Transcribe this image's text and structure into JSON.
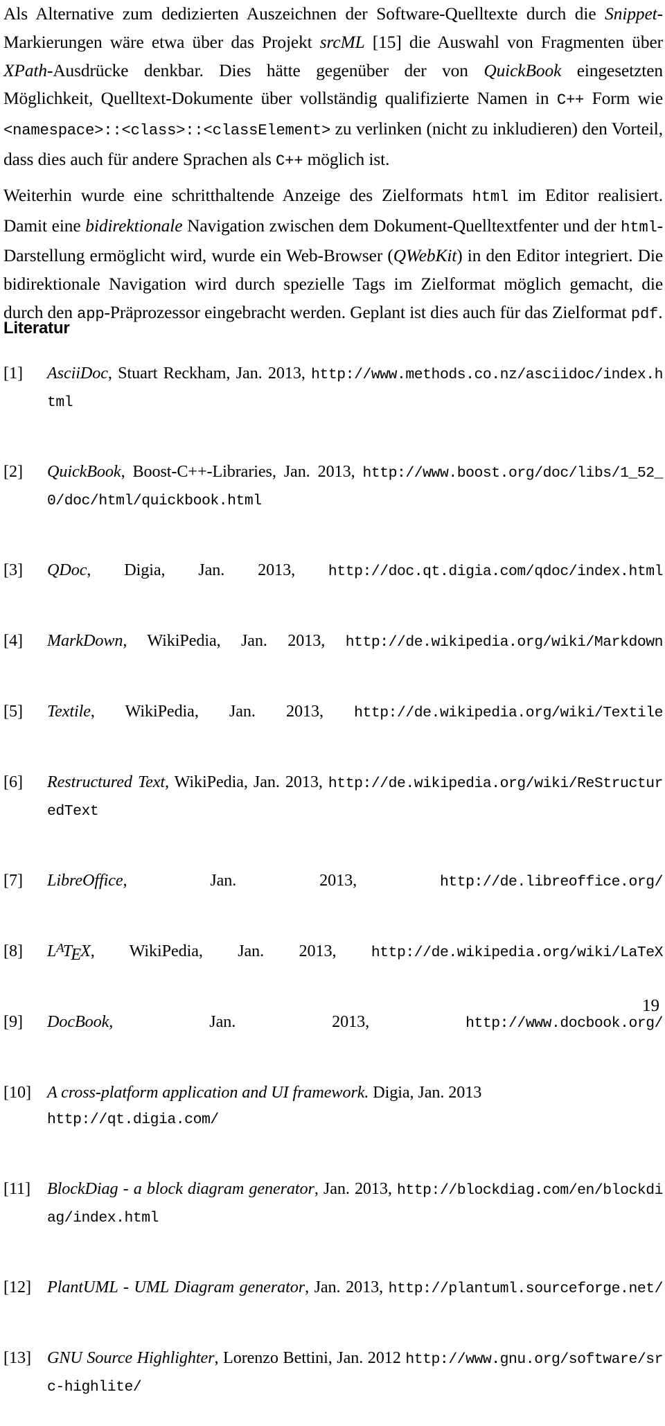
{
  "document": {
    "page_number": "19",
    "section_heading": "Literatur"
  },
  "paragraphs": [
    {
      "id": "paragraph-1",
      "segments": [
        {
          "text": "Als Alternative zum dedizierten Auszeichnen der Software-Quelltexte durch die ",
          "style": "normal"
        },
        {
          "text": "Snippet",
          "style": "italic"
        },
        {
          "text": "-Markierungen wäre etwa über das Projekt ",
          "style": "normal"
        },
        {
          "text": "srcML",
          "style": "italic"
        },
        {
          "text": " [15] die Auswahl von Fragmenten über ",
          "style": "normal"
        },
        {
          "text": "XPath",
          "style": "italic"
        },
        {
          "text": "-Ausdrücke denkbar. Dies hätte gegenüber der von ",
          "style": "normal"
        },
        {
          "text": "QuickBook",
          "style": "italic"
        },
        {
          "text": " eingesetzten Möglichkeit, Quelltext-Dokumente über vollständig qualifizierte Namen in ",
          "style": "normal"
        },
        {
          "text": "C++",
          "style": "mono"
        },
        {
          "text": " Form wie ",
          "style": "normal"
        },
        {
          "text": "<namespace>::<class>::<classElement>",
          "style": "mono"
        },
        {
          "text": " zu verlinken (nicht zu inkludieren) den Vorteil, dass dies auch für andere Sprachen als ",
          "style": "normal"
        },
        {
          "text": "C++",
          "style": "mono"
        },
        {
          "text": " möglich ist.",
          "style": "normal"
        }
      ]
    },
    {
      "id": "paragraph-2",
      "segments": [
        {
          "text": "Weiterhin wurde eine schritthaltende Anzeige des Zielformats ",
          "style": "normal"
        },
        {
          "text": "html",
          "style": "mono"
        },
        {
          "text": " im Editor realisiert. Damit eine ",
          "style": "normal"
        },
        {
          "text": "bidirektionale",
          "style": "italic"
        },
        {
          "text": " Navigation zwischen dem Dokument-Quelltextfenter und der ",
          "style": "normal"
        },
        {
          "text": "html",
          "style": "mono"
        },
        {
          "text": "-Darstellung ermöglicht wird, wurde ein Web-Browser (",
          "style": "normal"
        },
        {
          "text": "QWebKit",
          "style": "italic"
        },
        {
          "text": ") in den Editor integriert. Die bidirektionale Navigation wird durch spezielle Tags im Zielformat möglich gemacht, die durch den ",
          "style": "normal"
        },
        {
          "text": "app",
          "style": "mono"
        },
        {
          "text": "-Präprozessor eingebracht werden. Geplant ist dies auch für das Zielformat ",
          "style": "normal"
        },
        {
          "text": "pdf",
          "style": "mono"
        },
        {
          "text": ".",
          "style": "normal"
        }
      ]
    }
  ],
  "references": [
    {
      "label": "[1]",
      "segments": [
        {
          "text": "AsciiDoc",
          "style": "italic"
        },
        {
          "text": ", Stuart Reckham, Jan. 2013, ",
          "style": "normal"
        },
        {
          "text": "http://www.methods.co.nz/asciidoc/index.html",
          "style": "url"
        }
      ]
    },
    {
      "label": "[2]",
      "segments": [
        {
          "text": "QuickBook",
          "style": "italic"
        },
        {
          "text": ", Boost-C++-Libraries, Jan. 2013, ",
          "style": "normal"
        },
        {
          "text": "http://www.boost.org/doc/libs/1_52_0/doc/html/quickbook.html",
          "style": "url"
        }
      ]
    },
    {
      "label": "[3]",
      "segments": [
        {
          "text": "QDoc",
          "style": "italic"
        },
        {
          "text": ", Digia, Jan. 2013, ",
          "style": "normal"
        },
        {
          "text": "http://doc.qt.digia.com/qdoc/index.html",
          "style": "url"
        }
      ]
    },
    {
      "label": "[4]",
      "segments": [
        {
          "text": "MarkDown",
          "style": "italic"
        },
        {
          "text": ", WikiPedia, Jan. 2013, ",
          "style": "normal"
        },
        {
          "text": "http://de.wikipedia.org/wiki/Markdown",
          "style": "url"
        }
      ]
    },
    {
      "label": "[5]",
      "segments": [
        {
          "text": "Textile",
          "style": "italic"
        },
        {
          "text": ", WikiPedia, Jan. 2013, ",
          "style": "normal"
        },
        {
          "text": "http://de.wikipedia.org/wiki/Textile",
          "style": "url"
        }
      ]
    },
    {
      "label": "[6]",
      "segments": [
        {
          "text": "Restructured Text",
          "style": "italic"
        },
        {
          "text": ", WikiPedia, Jan. 2013, ",
          "style": "normal"
        },
        {
          "text": "http://de.wikipedia.org/wiki/ReStructuredText",
          "style": "url"
        }
      ]
    },
    {
      "label": "[7]",
      "segments": [
        {
          "text": "LibreOffice",
          "style": "italic"
        },
        {
          "text": ", Jan. 2013, ",
          "style": "normal"
        },
        {
          "text": "http://de.libreoffice.org/",
          "style": "url"
        }
      ]
    },
    {
      "label": "[8]",
      "segments": [
        {
          "text": "LaTeX",
          "style": "latex"
        },
        {
          "text": ", WikiPedia, Jan. 2013, ",
          "style": "normal"
        },
        {
          "text": "http://de.wikipedia.org/wiki/LaTeX",
          "style": "url"
        }
      ]
    },
    {
      "label": "[9]",
      "segments": [
        {
          "text": "DocBook",
          "style": "italic"
        },
        {
          "text": ", Jan. 2013, ",
          "style": "normal"
        },
        {
          "text": "http://www.docbook.org/",
          "style": "url"
        }
      ]
    },
    {
      "label": "[10]",
      "segments": [
        {
          "text": "A cross-platform application and UI framework.",
          "style": "italic"
        },
        {
          "text": " Digia, Jan. 2013",
          "style": "normal"
        },
        {
          "text": "BREAK",
          "style": "break"
        },
        {
          "text": "http://qt.digia.com/",
          "style": "url"
        }
      ]
    },
    {
      "label": "[11]",
      "segments": [
        {
          "text": "BlockDiag - a block diagram generator",
          "style": "italic"
        },
        {
          "text": ", Jan. 2013, ",
          "style": "normal"
        },
        {
          "text": "http://blockdiag.com/en/blockdiag/index.html",
          "style": "url"
        }
      ]
    },
    {
      "label": "[12]",
      "segments": [
        {
          "text": "PlantUML - UML Diagram generator",
          "style": "italic"
        },
        {
          "text": ", Jan. 2013, ",
          "style": "normal"
        },
        {
          "text": "http://plantuml.sourceforge.net/",
          "style": "url"
        }
      ]
    },
    {
      "label": "[13]",
      "segments": [
        {
          "text": "GNU Source Highlighter",
          "style": "italic"
        },
        {
          "text": ", Lorenzo Bettini, Jan. 2012 ",
          "style": "normal"
        },
        {
          "text": "http://www.gnu.org/software/src-highlite/",
          "style": "url"
        }
      ]
    }
  ]
}
